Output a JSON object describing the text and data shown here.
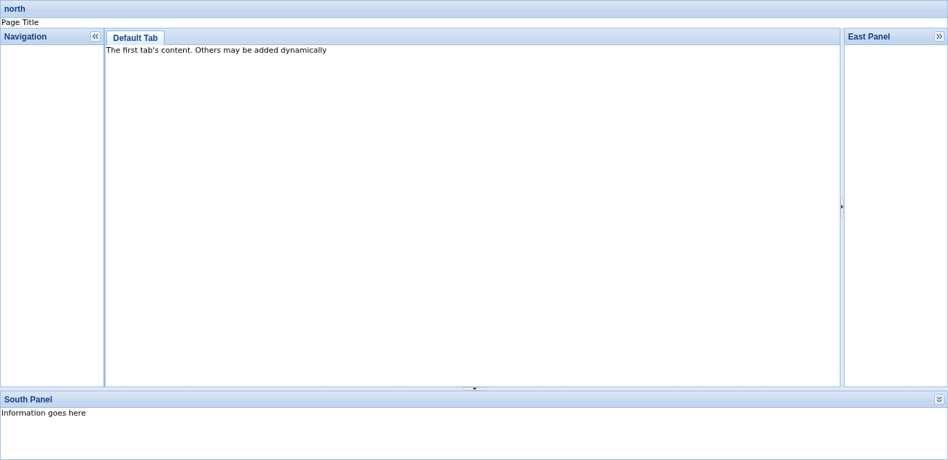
{
  "north": {
    "title": "north",
    "content": "Page Title"
  },
  "west": {
    "title": "Navigation"
  },
  "center": {
    "tabs": [
      {
        "label": "Default Tab",
        "selected": true
      }
    ],
    "content": "The first tab's content. Others may be added dynamically"
  },
  "east": {
    "title": "East Panel"
  },
  "south": {
    "title": "South Panel",
    "content": "Information goes here"
  }
}
